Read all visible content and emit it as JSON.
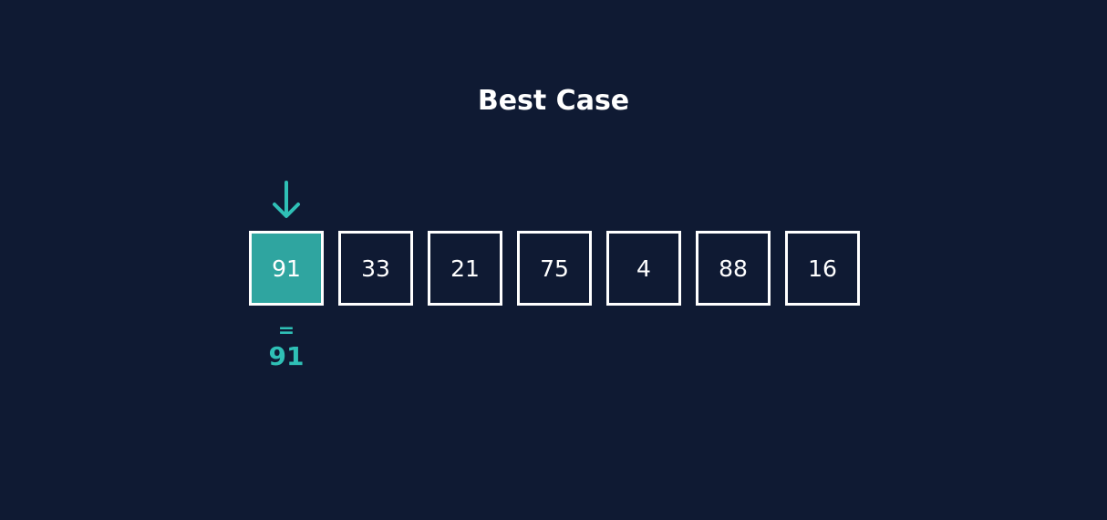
{
  "title": "Best Case",
  "array": {
    "values": [
      "91",
      "33",
      "21",
      "75",
      "4",
      "88",
      "16"
    ],
    "highlighted_index": 0
  },
  "pointer": {
    "icon": "arrow-down-icon",
    "color": "#2fc0b6"
  },
  "comparison": {
    "symbol": "=",
    "value": "91"
  },
  "colors": {
    "background": "#0f1a33",
    "highlight": "#2fa5a0",
    "accent": "#2fc0b6",
    "border": "#ffffff"
  }
}
